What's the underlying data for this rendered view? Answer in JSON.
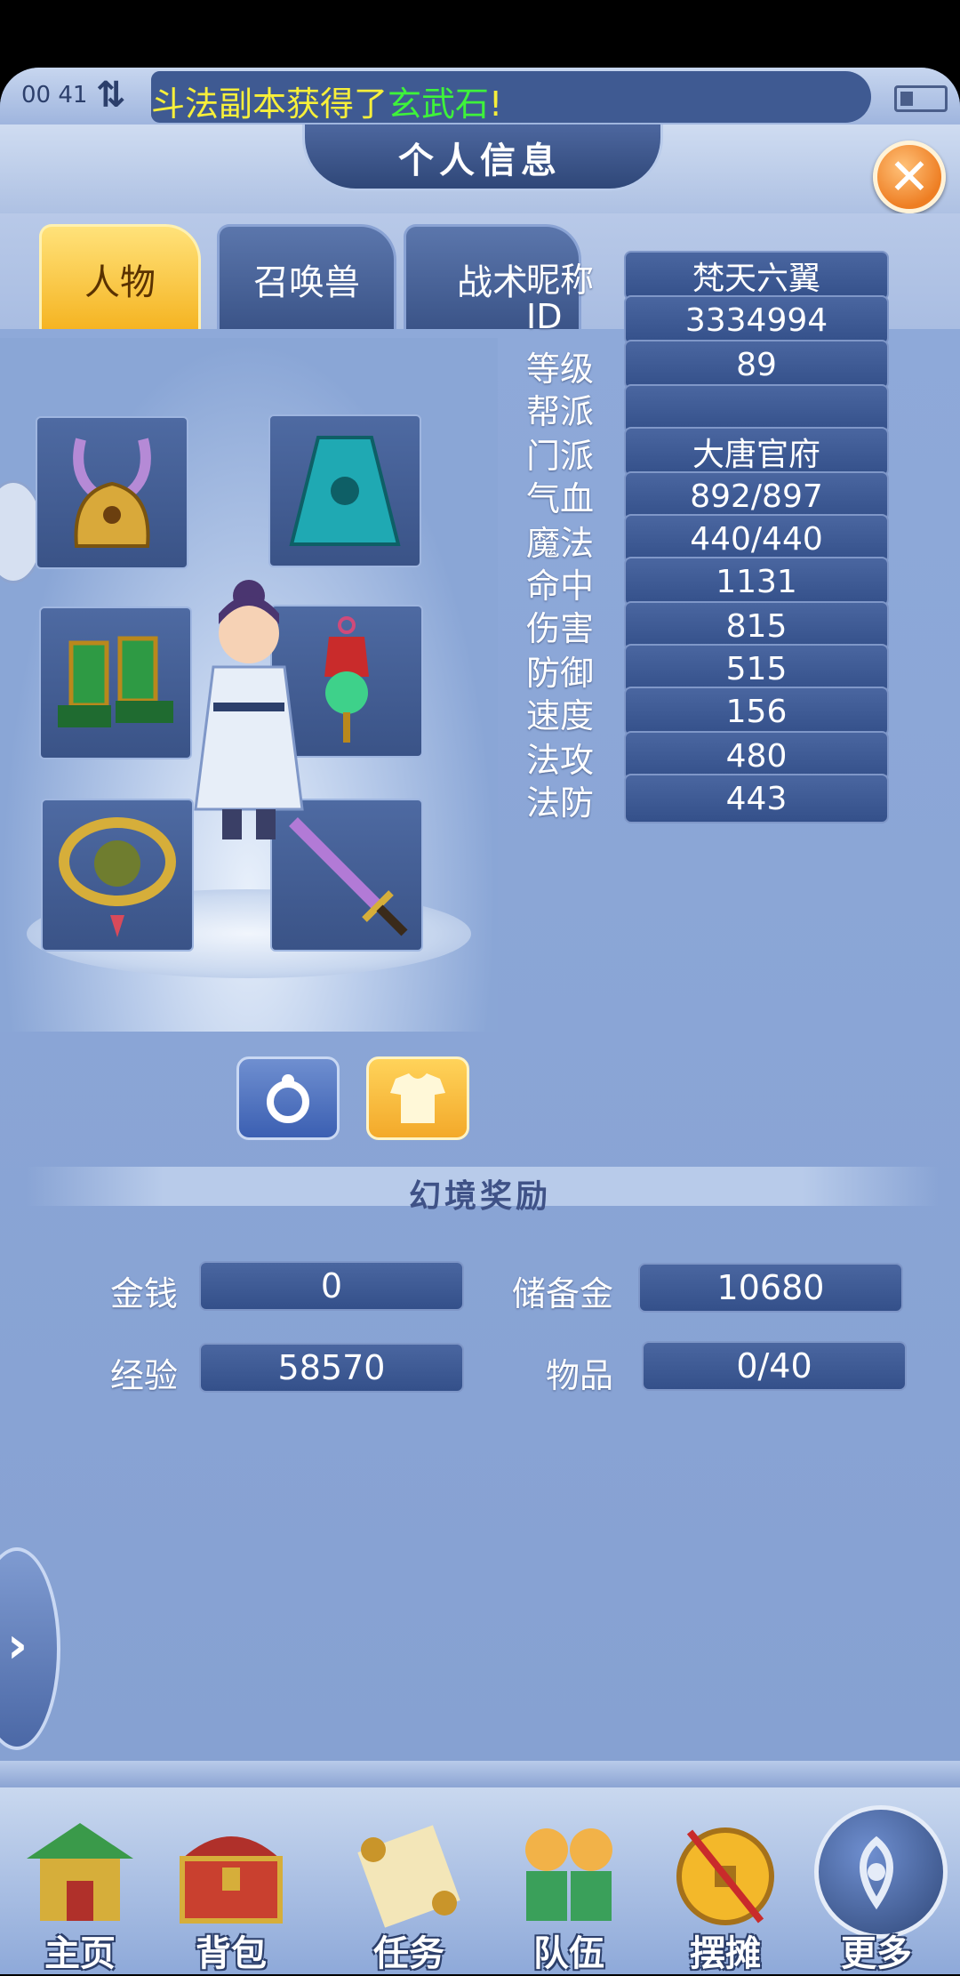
{
  "status": {
    "time": "00 41",
    "marquee_prefix": "斗法副本获得了",
    "marquee_item": "玄武石",
    "marquee_suffix": "!"
  },
  "header": {
    "title": "个人信息"
  },
  "tabs": [
    {
      "label": "人物",
      "active": true
    },
    {
      "label": "召唤兽",
      "active": false
    },
    {
      "label": "战术",
      "active": false
    }
  ],
  "equipment": {
    "slots": [
      {
        "name": "helmet",
        "icon": "helmet-icon"
      },
      {
        "name": "cape",
        "icon": "cape-icon"
      },
      {
        "name": "boots",
        "icon": "boots-icon"
      },
      {
        "name": "charm",
        "icon": "charm-icon"
      },
      {
        "name": "ring",
        "icon": "ring-icon"
      },
      {
        "name": "weapon",
        "icon": "sword-icon"
      }
    ]
  },
  "stats": [
    {
      "label": "昵称",
      "value": "梵天六翼"
    },
    {
      "label": "ID",
      "value": "3334994"
    },
    {
      "label": "等级",
      "value": "89"
    },
    {
      "label": "帮派",
      "value": ""
    },
    {
      "label": "门派",
      "value": "大唐官府"
    },
    {
      "label": "气血",
      "value": "892/897"
    },
    {
      "label": "魔法",
      "value": "440/440"
    },
    {
      "label": "命中",
      "value": "1131"
    },
    {
      "label": "伤害",
      "value": "815"
    },
    {
      "label": "防御",
      "value": "515"
    },
    {
      "label": "速度",
      "value": "156"
    },
    {
      "label": "法攻",
      "value": "480"
    },
    {
      "label": "法防",
      "value": "443"
    }
  ],
  "rewards": {
    "title": "幻境奖励",
    "money_label": "金钱",
    "money_value": "0",
    "reserve_label": "储备金",
    "reserve_value": "10680",
    "exp_label": "经验",
    "exp_value": "58570",
    "items_label": "物品",
    "items_value": "0/40"
  },
  "bottom_nav": [
    {
      "label": "主页",
      "icon": "pavilion-icon"
    },
    {
      "label": "背包",
      "icon": "treasure-chest-icon"
    },
    {
      "label": "任务",
      "icon": "scroll-icon"
    },
    {
      "label": "队伍",
      "icon": "team-icon"
    },
    {
      "label": "摆摊",
      "icon": "coin-icon"
    },
    {
      "label": "更多",
      "icon": "more-icon"
    }
  ],
  "colors": {
    "panel": "#8aa6d6",
    "field": "#3f5a92",
    "active_tab": "#f5b320",
    "marquee_text": "#f7ef3a",
    "marquee_highlight": "#3ef33a",
    "close_button": "#ee7e23"
  }
}
